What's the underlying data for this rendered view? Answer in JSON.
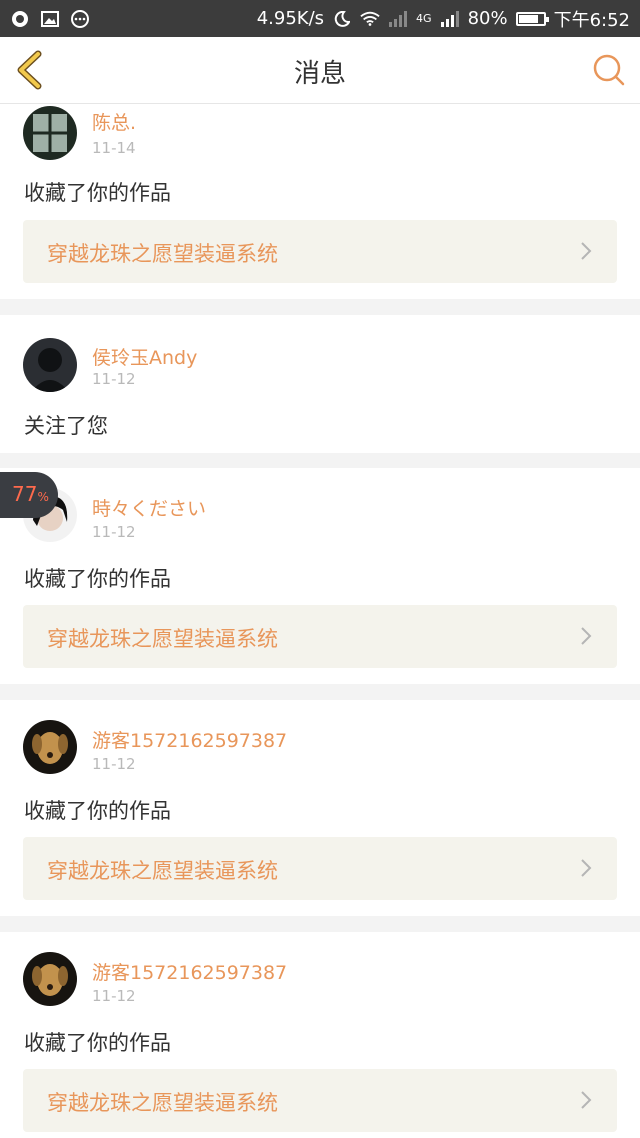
{
  "status_bar": {
    "speed": "4.95K/s",
    "network": "4G",
    "battery": "80%",
    "battery_level": 0.8,
    "time": "下午6:52"
  },
  "header": {
    "title": "消息"
  },
  "colors": {
    "accent": "#e8965a",
    "text": "#333333",
    "muted": "#b9b9b9",
    "work_bg": "#f4f3ec"
  },
  "messages": [
    {
      "user": "陈总.",
      "time": "11-14",
      "action": "收藏了你的作品",
      "work": "穿越龙珠之愿望装逼系统"
    },
    {
      "user": "侯玲玉Andy",
      "time": "11-12",
      "action": "关注了您",
      "work": ""
    },
    {
      "user": "時々ください",
      "time": "11-12",
      "action": "收藏了你的作品",
      "work": "穿越龙珠之愿望装逼系统"
    },
    {
      "user": "游客1572162597387",
      "time": "11-12",
      "action": "收藏了你的作品",
      "work": "穿越龙珠之愿望装逼系统"
    },
    {
      "user": "游客1572162597387",
      "time": "11-12",
      "action": "收藏了你的作品",
      "work": "穿越龙珠之愿望装逼系统"
    }
  ],
  "overlay": {
    "percent": "77",
    "unit": "%"
  }
}
